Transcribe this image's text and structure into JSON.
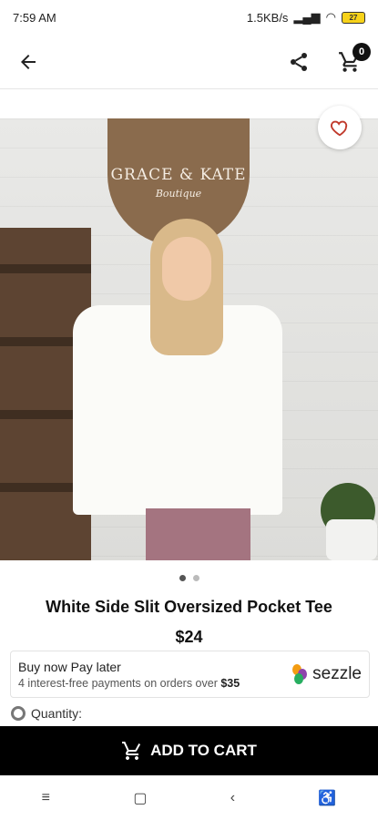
{
  "status_bar": {
    "time": "7:59 AM",
    "network": "1.5KB/s",
    "battery": "27"
  },
  "app_bar": {
    "cart_count": "0"
  },
  "product_image": {
    "sign_brand": "GRACE & KATE",
    "sign_script": "Boutique"
  },
  "product": {
    "title": "White Side Slit Oversized Pocket Tee",
    "price": "$24"
  },
  "payment": {
    "line1": "Buy now Pay later",
    "line2_prefix": "4 interest-free payments on orders over ",
    "line2_amount": "$35",
    "provider": "sezzle"
  },
  "quantity_label": "Quantity:",
  "add_to_cart_label": "ADD TO CART",
  "colors": {
    "primary": "#000000",
    "favorite_accent": "#c0392b"
  }
}
